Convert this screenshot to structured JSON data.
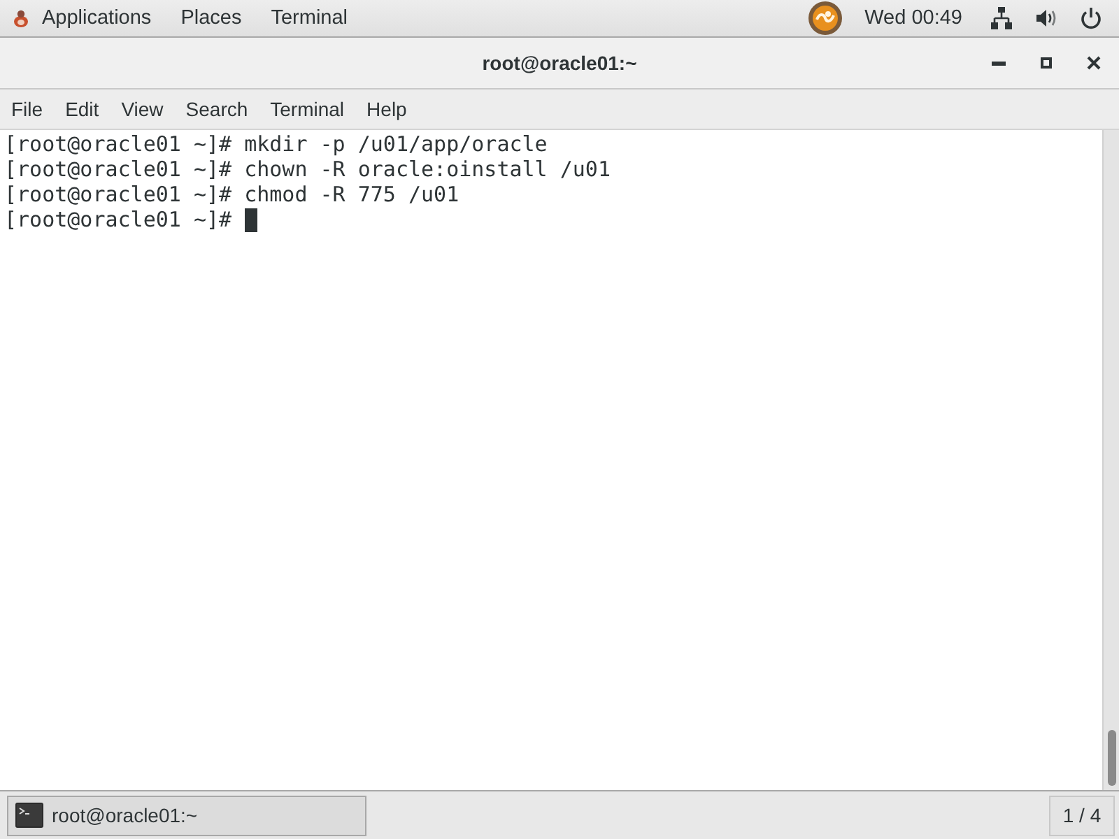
{
  "top_bar": {
    "menus": [
      "Applications",
      "Places",
      "Terminal"
    ],
    "clock": "Wed 00:49"
  },
  "window": {
    "title": "root@oracle01:~"
  },
  "menu_bar": [
    "File",
    "Edit",
    "View",
    "Search",
    "Terminal",
    "Help"
  ],
  "terminal": {
    "lines": [
      "[root@oracle01 ~]# mkdir -p /u01/app/oracle",
      "[root@oracle01 ~]# chown -R oracle:oinstall /u01",
      "[root@oracle01 ~]# chmod -R 775 /u01",
      "[root@oracle01 ~]#"
    ],
    "cursor": true
  },
  "taskbar": {
    "tasks": [
      {
        "label": "root@oracle01:~",
        "selected": true
      }
    ],
    "workspace": "1 / 4"
  }
}
